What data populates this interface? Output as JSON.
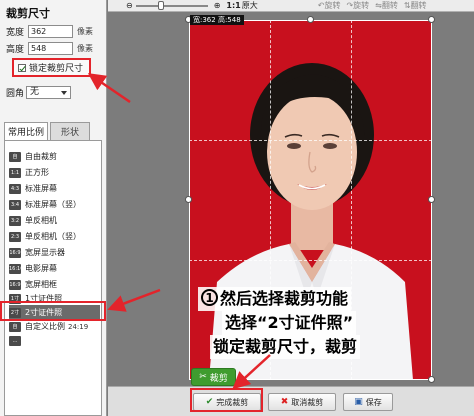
{
  "left_panel": {
    "section_title": "裁剪尺寸",
    "width_label": "宽度",
    "width_value": "362",
    "height_label": "高度",
    "height_value": "548",
    "unit": "像素",
    "lock_label": "锁定裁剪尺寸",
    "round_label": "圆角",
    "round_value": "无",
    "tabs": [
      "常用比例",
      "形状"
    ],
    "ratio_items": [
      {
        "icon": "自",
        "label": "自由裁剪"
      },
      {
        "icon": "1:1",
        "label": "正方形"
      },
      {
        "icon": "4:3",
        "label": "标准屏幕"
      },
      {
        "icon": "3:4",
        "label": "标准屏幕（竖）"
      },
      {
        "icon": "3:2",
        "label": "单反相机"
      },
      {
        "icon": "2:3",
        "label": "单反相机（竖）"
      },
      {
        "icon": "16:9",
        "label": "宽屏显示器"
      },
      {
        "icon": "16:10",
        "label": "电影屏幕"
      },
      {
        "icon": "16:9",
        "label": "宽屏相框"
      },
      {
        "icon": "1寸",
        "label": "1寸证件照"
      },
      {
        "icon": "2寸",
        "label": "2寸证件照"
      },
      {
        "icon": "自",
        "label": "自定义比例",
        "hint": "24:19"
      },
      {
        "icon": "…",
        "label": ""
      }
    ]
  },
  "toolbar": {
    "zoom_label": "1:1",
    "fit_label": "原大",
    "rotate_left": "旋转",
    "rotate_right": "旋转",
    "flip_h": "翻转",
    "flip_v": "翻转"
  },
  "canvas": {
    "dimension_label": "宽:362 高:548",
    "crop_button": "裁剪",
    "caption_number": "1",
    "caption_line1": "然后选择裁剪功能",
    "caption_line2": "选择“2寸证件照”",
    "caption_line3": "锁定裁剪尺寸，裁剪"
  },
  "bottom_bar": {
    "done_label": "完成裁剪",
    "cancel_label": "取消裁剪",
    "save_label": "保存"
  },
  "colors": {
    "photo_background": "#c8101e",
    "highlight_red": "#e3242b",
    "crop_green": "#3f9c2f"
  }
}
